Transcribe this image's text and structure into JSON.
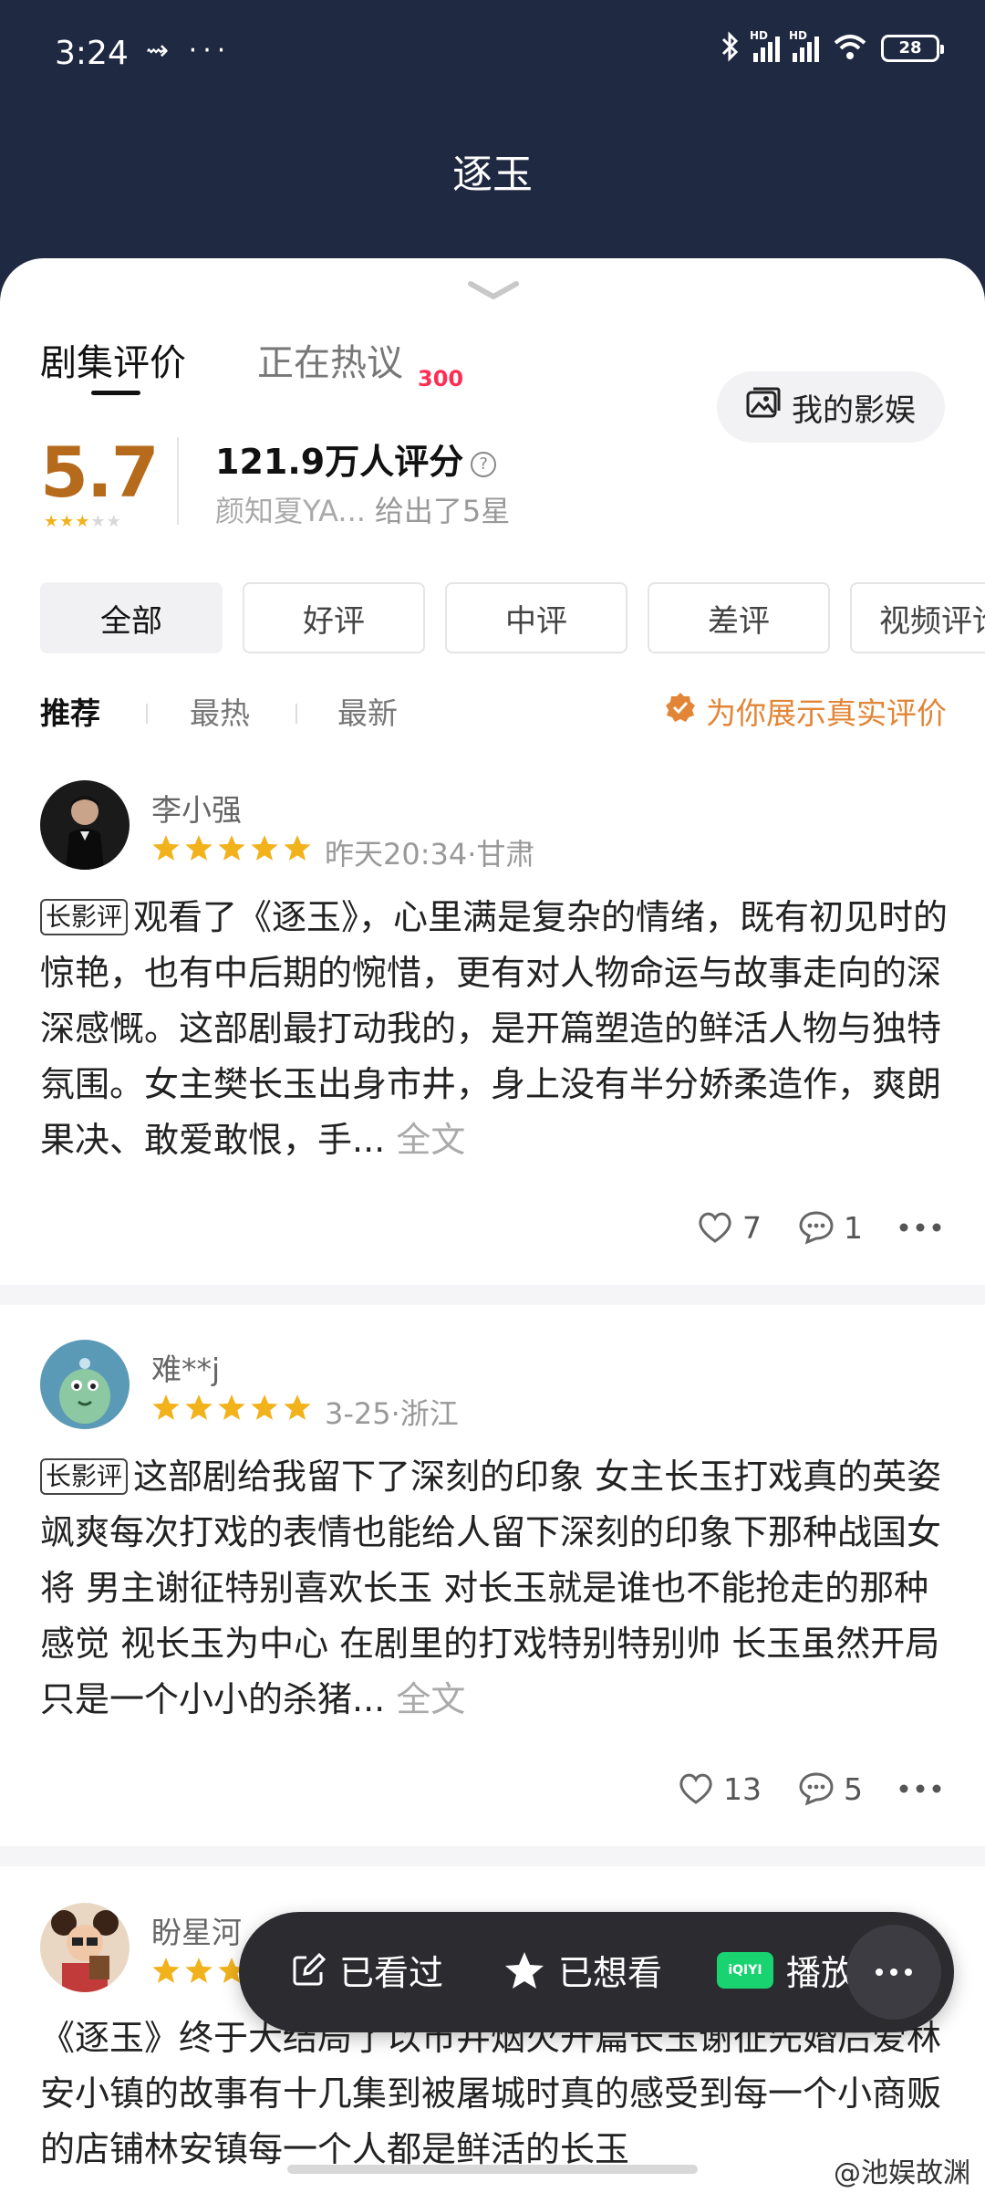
{
  "status_bar": {
    "time": "3:24",
    "left_icons": "⇝ ···",
    "hd": "HD",
    "battery": "28"
  },
  "app_title": "逐玉",
  "tabs": {
    "active": "剧集评价",
    "inactive": "正在热议",
    "badge": "300",
    "my_button": "我的影娱"
  },
  "rating": {
    "score": "5.7",
    "stars_on": 3,
    "stars_total": 5,
    "count": "121.9万人评分",
    "rater": "颜知夏YA...",
    "gave": "给出了5星"
  },
  "filters": [
    "全部",
    "好评",
    "中评",
    "差评",
    "视频评论"
  ],
  "sort": {
    "items": [
      "推荐",
      "最热",
      "最新"
    ],
    "real_label": "为你展示真实评价"
  },
  "reviews": [
    {
      "user": "李小强",
      "meta": "昨天20:34·甘肃",
      "tag": "长影评",
      "text": "观看了《逐玉》，心里满是复杂的情绪，既有初见时的惊艳，也有中后期的惋惜，更有对人物命运与故事走向的深深感慨。这部剧最打动我的，是开篇塑造的鲜活人物与独特氛围。女主樊长玉出身市井，身上没有半分娇柔造作，爽朗果决、敢爱敢恨，手...",
      "more": "全文",
      "likes": "7",
      "comments": "1"
    },
    {
      "user": "难**j",
      "meta": "3-25·浙江",
      "tag": "长影评",
      "text": "这部剧给我留下了深刻的印象 女主长玉打戏真的英姿飒爽每次打戏的表情也能给人留下深刻的印象下那种战国女将  男主谢征特别喜欢长玉 对长玉就是谁也不能抢走的那种感觉 视长玉为中心 在剧里的打戏特别特别帅 长玉虽然开局只是一个小小的杀猪...",
      "more": "全文",
      "likes": "13",
      "comments": "5"
    },
    {
      "user": "盼星河",
      "text": "《逐玉》终于大结局了以市井烟火开篇长玉谢征先婚后爱林安小镇的故事有十几集到被屠城时真的感受到每一个小商贩的店铺林安镇每一个人都是鲜活的长玉"
    }
  ],
  "float_bar": {
    "watched": "已看过",
    "want": "已想看",
    "play": "播放",
    "iqiyi": "iQIYI"
  },
  "watermark": "@池娱故渊",
  "colors": {
    "header_bg": "#1f2942",
    "score": "#b56a1c",
    "star": "#f2b21c",
    "accent": "#e28536",
    "badge": "#ff2d55"
  }
}
